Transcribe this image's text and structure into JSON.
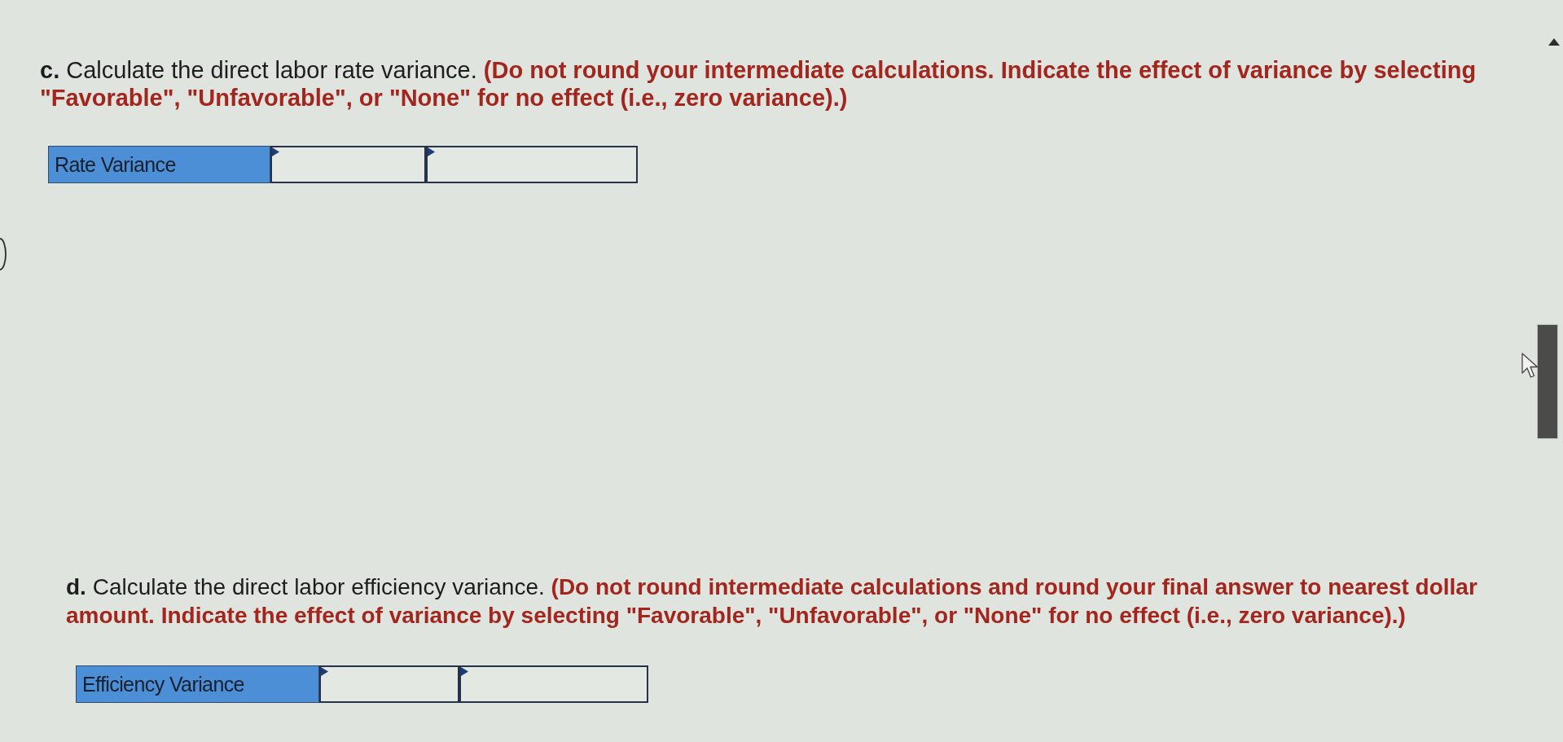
{
  "questions": [
    {
      "label": "c.",
      "text": "Calculate the direct labor rate variance.",
      "instruction": "(Do not round your intermediate calculations. Indicate the effect of variance by selecting \"Favorable\", \"Unfavorable\", or \"None\" for no effect (i.e., zero variance).)",
      "answer_row": {
        "label": "Rate Variance",
        "fields": [
          {
            "kind": "amount"
          },
          {
            "kind": "effect"
          }
        ]
      }
    },
    {
      "label": "d.",
      "text": "Calculate the direct labor efficiency variance.",
      "instruction": "(Do not round intermediate calculations and round your final answer to nearest dollar amount. Indicate the effect of variance by selecting \"Favorable\", \"Unfavorable\", or \"None\" for no effect (i.e., zero variance).)",
      "answer_row": {
        "label": "Efficiency Variance",
        "fields": [
          {
            "kind": "amount"
          },
          {
            "kind": "effect"
          }
        ]
      }
    }
  ]
}
